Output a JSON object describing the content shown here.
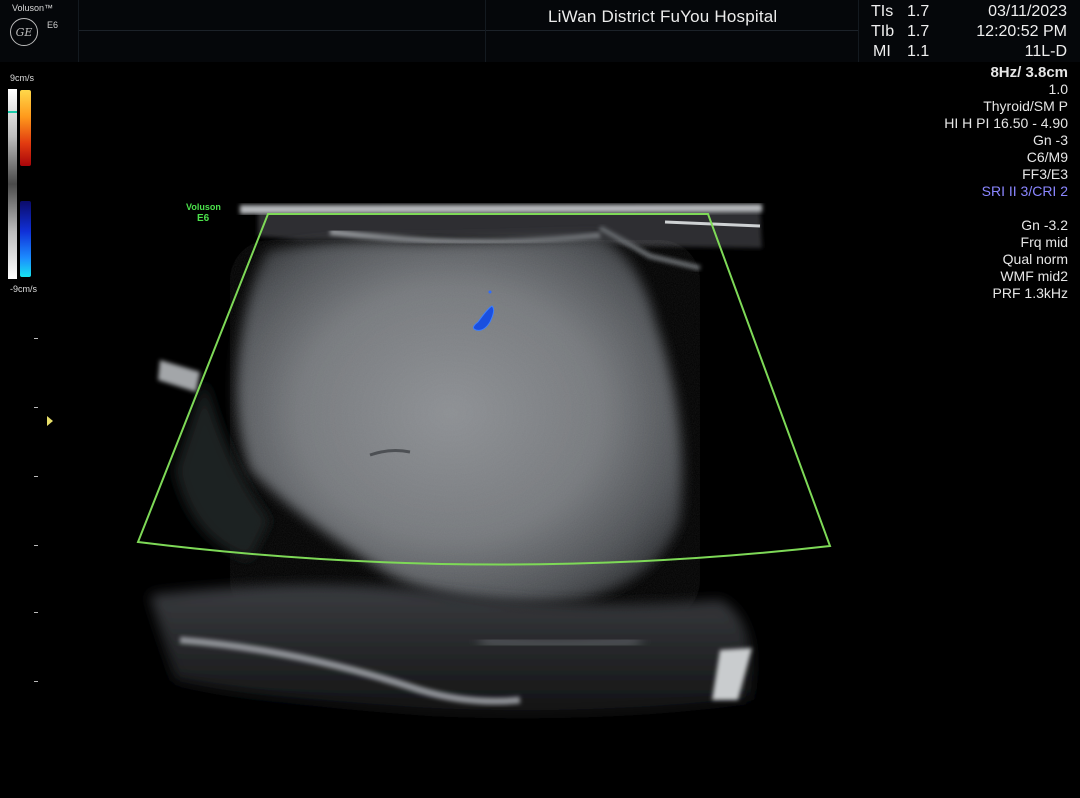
{
  "header": {
    "brand": "Voluson™",
    "model": "E6",
    "logo_text": "GE",
    "hospital": "LiWan District FuYou Hospital",
    "indices": [
      {
        "label": "TIs",
        "value": "1.7"
      },
      {
        "label": "TIb",
        "value": "1.7"
      },
      {
        "label": "MI",
        "value": "1.1"
      }
    ],
    "date": "03/11/2023",
    "time": "12:20:52 PM",
    "probe": "11L-D"
  },
  "params": {
    "frame_depth": "8Hz/ 3.8cm",
    "zoom": "1.0",
    "preset": "Thyroid/SM P",
    "harmonics": "HI H PI 16.50 - 4.90",
    "gain": "Gn  -3",
    "maps": "C6/M9",
    "ff": "FF3/E3",
    "sri": "SRI II 3/CRI 2",
    "color_gain": "Gn -3.2",
    "freq": "Frq mid",
    "quality": "Qual norm",
    "wmf": "WMF mid2",
    "prf": "PRF  1.3kHz"
  },
  "scale": {
    "top_label": "9cm/s",
    "bottom_label": "-9cm/s"
  },
  "color_box_label": {
    "line1": "Voluson",
    "line2": "E6"
  },
  "colors": {
    "roi_box": "#7ed957",
    "sri_text": "#8a86ff",
    "doppler_blue": "#1a4fe0",
    "focus_marker": "#e8df6a"
  },
  "icons": [
    "ge-logo-icon",
    "focus-marker-icon"
  ]
}
